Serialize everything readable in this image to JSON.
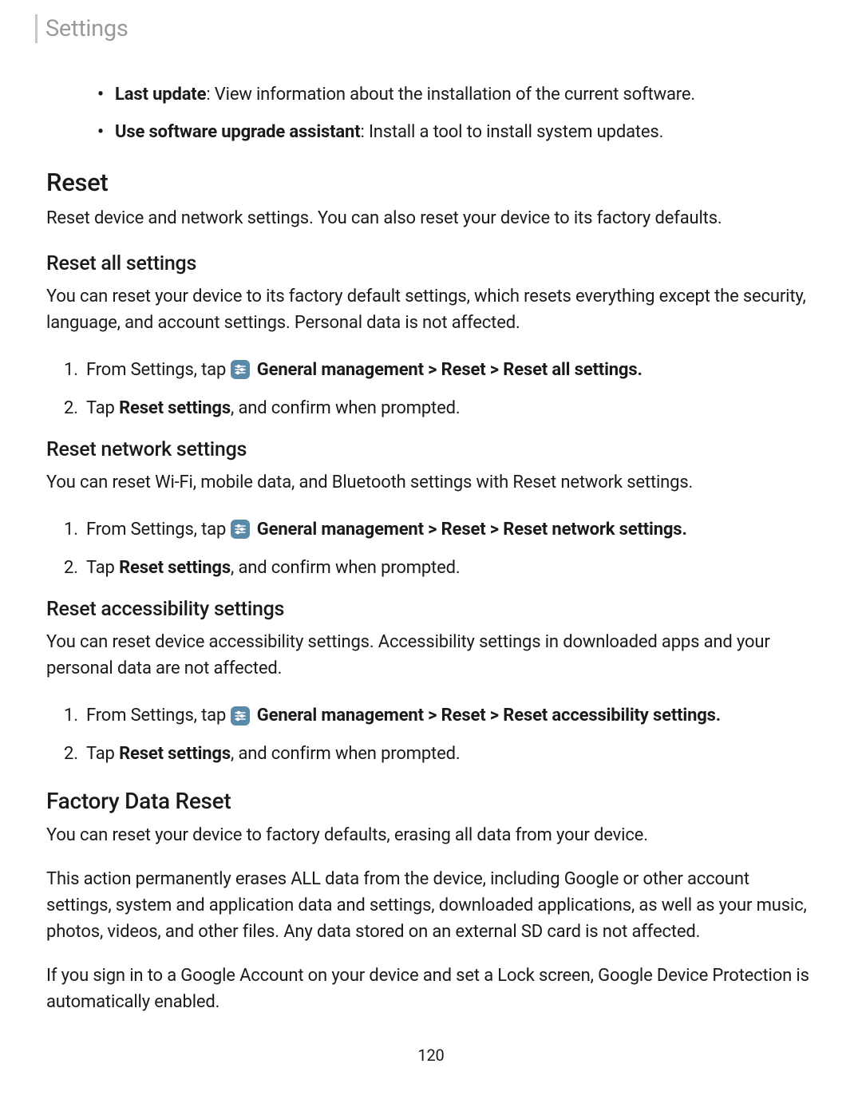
{
  "header": {
    "title": "Settings"
  },
  "top_bullets": [
    {
      "bold": "Last update",
      "rest": ": View information about the installation of the current software."
    },
    {
      "bold": "Use software upgrade assistant",
      "rest": ": Install a tool to install system updates."
    }
  ],
  "reset_section": {
    "heading": "Reset",
    "desc": "Reset device and network settings. You can also reset your device to its factory defaults."
  },
  "reset_all": {
    "heading": "Reset all settings",
    "desc": "You can reset your device to its factory default settings, which resets everything except the security, language, and account settings. Personal data is not affected.",
    "step1_intro": "From Settings, tap ",
    "step1_path": "General management > Reset > Reset all settings.",
    "step2_pre": "Tap ",
    "step2_bold": "Reset settings",
    "step2_post": ", and confirm when prompted."
  },
  "reset_network": {
    "heading": "Reset network settings",
    "desc": "You can reset Wi-Fi, mobile data, and Bluetooth settings with Reset network settings.",
    "step1_intro": "From Settings, tap ",
    "step1_path": "General management > Reset > Reset network settings.",
    "step2_pre": "Tap ",
    "step2_bold": "Reset settings",
    "step2_post": ", and confirm when prompted."
  },
  "reset_accessibility": {
    "heading": "Reset accessibility settings",
    "desc": "You can reset device accessibility settings. Accessibility settings in downloaded apps and your personal data are not affected.",
    "step1_intro": "From Settings, tap ",
    "step1_path": "General management > Reset > Reset accessibility settings.",
    "step2_pre": "Tap ",
    "step2_bold": "Reset settings",
    "step2_post": ", and confirm when prompted."
  },
  "factory_reset": {
    "heading": "Factory Data Reset",
    "para1": "You can reset your device to factory defaults, erasing all data from your device.",
    "para2": "This action permanently erases ALL data from the device, including Google or other account settings, system and application data and settings, downloaded applications, as well as your music, photos, videos, and other files. Any data stored on an external SD card is not affected.",
    "para3": "If you sign in to a Google Account on your device and set a Lock screen, Google Device Protection is automatically enabled."
  },
  "page_number": "120"
}
